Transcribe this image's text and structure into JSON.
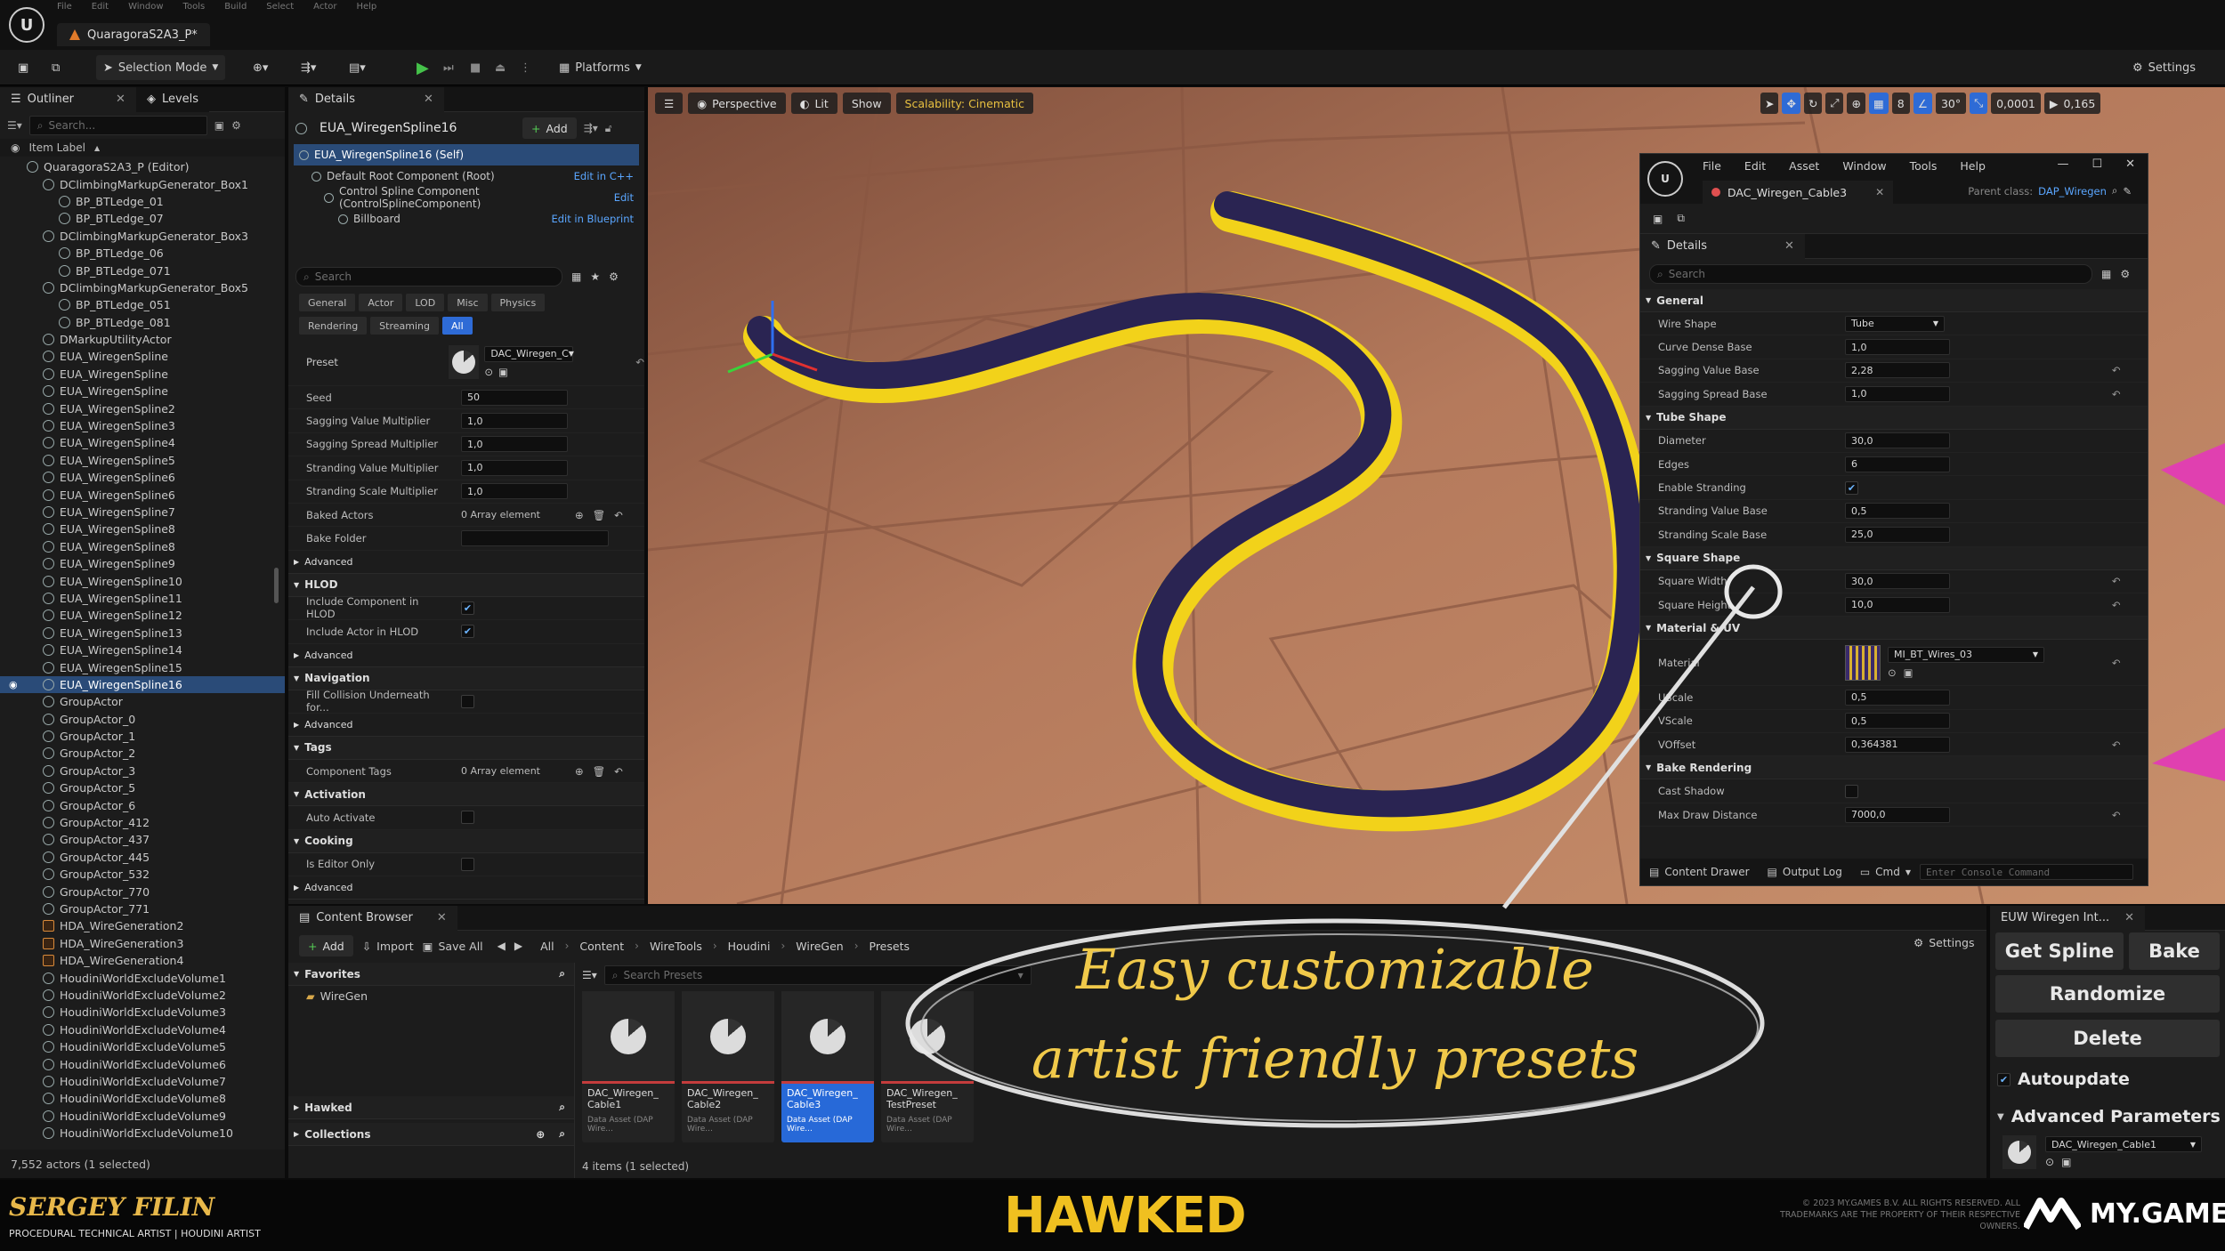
{
  "menu": {
    "items": [
      "File",
      "Edit",
      "Window",
      "Tools",
      "Build",
      "Select",
      "Actor",
      "Help"
    ]
  },
  "title_tab": "QuaragoraS2A3_P*",
  "toolbar": {
    "selection_mode": "Selection Mode",
    "platforms": "Platforms",
    "settings": "Settings"
  },
  "outliner": {
    "tab": "Outliner",
    "levels_tab": "Levels",
    "search_placeholder": "Search...",
    "column": "Item Label",
    "rows": [
      {
        "label": "QuaragoraS2A3_P (Editor)",
        "indent": 1
      },
      {
        "label": "DClimbingMarkupGenerator_Box1",
        "indent": 2
      },
      {
        "label": "BP_BTLedge_01",
        "indent": 3
      },
      {
        "label": "BP_BTLedge_07",
        "indent": 3
      },
      {
        "label": "DClimbingMarkupGenerator_Box3",
        "indent": 2
      },
      {
        "label": "BP_BTLedge_06",
        "indent": 3
      },
      {
        "label": "BP_BTLedge_071",
        "indent": 3
      },
      {
        "label": "DClimbingMarkupGenerator_Box5",
        "indent": 2
      },
      {
        "label": "BP_BTLedge_051",
        "indent": 3
      },
      {
        "label": "BP_BTLedge_081",
        "indent": 3
      },
      {
        "label": "DMarkupUtilityActor",
        "indent": 2
      },
      {
        "label": "EUA_WiregenSpline",
        "indent": 2
      },
      {
        "label": "EUA_WiregenSpline",
        "indent": 2
      },
      {
        "label": "EUA_WiregenSpline",
        "indent": 2
      },
      {
        "label": "EUA_WiregenSpline2",
        "indent": 2
      },
      {
        "label": "EUA_WiregenSpline3",
        "indent": 2
      },
      {
        "label": "EUA_WiregenSpline4",
        "indent": 2
      },
      {
        "label": "EUA_WiregenSpline5",
        "indent": 2
      },
      {
        "label": "EUA_WiregenSpline6",
        "indent": 2
      },
      {
        "label": "EUA_WiregenSpline6",
        "indent": 2
      },
      {
        "label": "EUA_WiregenSpline7",
        "indent": 2
      },
      {
        "label": "EUA_WiregenSpline8",
        "indent": 2
      },
      {
        "label": "EUA_WiregenSpline8",
        "indent": 2
      },
      {
        "label": "EUA_WiregenSpline9",
        "indent": 2
      },
      {
        "label": "EUA_WiregenSpline10",
        "indent": 2
      },
      {
        "label": "EUA_WiregenSpline11",
        "indent": 2
      },
      {
        "label": "EUA_WiregenSpline12",
        "indent": 2
      },
      {
        "label": "EUA_WiregenSpline13",
        "indent": 2
      },
      {
        "label": "EUA_WiregenSpline14",
        "indent": 2
      },
      {
        "label": "EUA_WiregenSpline15",
        "indent": 2
      },
      {
        "label": "EUA_WiregenSpline16",
        "indent": 2,
        "selected": true
      },
      {
        "label": "GroupActor",
        "indent": 2
      },
      {
        "label": "GroupActor_0",
        "indent": 2
      },
      {
        "label": "GroupActor_1",
        "indent": 2
      },
      {
        "label": "GroupActor_2",
        "indent": 2
      },
      {
        "label": "GroupActor_3",
        "indent": 2
      },
      {
        "label": "GroupActor_5",
        "indent": 2
      },
      {
        "label": "GroupActor_6",
        "indent": 2
      },
      {
        "label": "GroupActor_412",
        "indent": 2
      },
      {
        "label": "GroupActor_437",
        "indent": 2
      },
      {
        "label": "GroupActor_445",
        "indent": 2
      },
      {
        "label": "GroupActor_532",
        "indent": 2
      },
      {
        "label": "GroupActor_770",
        "indent": 2
      },
      {
        "label": "GroupActor_771",
        "indent": 2
      },
      {
        "label": "HDA_WireGeneration2",
        "indent": 2,
        "hda": true
      },
      {
        "label": "HDA_WireGeneration3",
        "indent": 2,
        "hda": true
      },
      {
        "label": "HDA_WireGeneration4",
        "indent": 2,
        "hda": true
      },
      {
        "label": "HoudiniWorldExcludeVolume1",
        "indent": 2
      },
      {
        "label": "HoudiniWorldExcludeVolume2",
        "indent": 2
      },
      {
        "label": "HoudiniWorldExcludeVolume3",
        "indent": 2
      },
      {
        "label": "HoudiniWorldExcludeVolume4",
        "indent": 2
      },
      {
        "label": "HoudiniWorldExcludeVolume5",
        "indent": 2
      },
      {
        "label": "HoudiniWorldExcludeVolume6",
        "indent": 2
      },
      {
        "label": "HoudiniWorldExcludeVolume7",
        "indent": 2
      },
      {
        "label": "HoudiniWorldExcludeVolume8",
        "indent": 2
      },
      {
        "label": "HoudiniWorldExcludeVolume9",
        "indent": 2
      },
      {
        "label": "HoudiniWorldExcludeVolume10",
        "indent": 2
      }
    ],
    "status": "7,552 actors (1 selected)"
  },
  "details": {
    "tab": "Details",
    "actor": "EUA_WiregenSpline16",
    "add": "Add",
    "components": [
      {
        "label": "EUA_WiregenSpline16 (Self)",
        "link": ""
      },
      {
        "label": "Default Root Component (Root)",
        "link": "Edit in C++"
      },
      {
        "label": "Control Spline Component (ControlSplineComponent)",
        "link": "Edit"
      },
      {
        "label": "Billboard",
        "link": "Edit in Blueprint"
      }
    ],
    "search_placeholder": "Search",
    "filters_row1": [
      "General",
      "Actor",
      "LOD",
      "Misc",
      "Physics"
    ],
    "filters_row2": [
      "Rendering",
      "Streaming",
      "All"
    ],
    "preset_label": "Preset",
    "preset_value": "DAC_Wiregen_C",
    "props": [
      {
        "label": "Seed",
        "value": "50"
      },
      {
        "label": "Sagging Value Multiplier",
        "value": "1,0"
      },
      {
        "label": "Sagging Spread Multiplier",
        "value": "1,0"
      },
      {
        "label": "Stranding Value Multiplier",
        "value": "1,0"
      },
      {
        "label": "Stranding Scale Multiplier",
        "value": "1,0"
      }
    ],
    "baked_actors": "Baked Actors",
    "array_element": "0 Array element",
    "bake_folder": "Bake Folder",
    "advanced": "Advanced",
    "hlod": "HLOD",
    "include_component": "Include Component in HLOD",
    "include_actor": "Include Actor in HLOD",
    "navigation": "Navigation",
    "fill_collision": "Fill Collision Underneath for...",
    "tags": "Tags",
    "component_tags": "Component Tags",
    "activation": "Activation",
    "auto_activate": "Auto Activate",
    "cooking": "Cooking",
    "is_editor_only": "Is Editor Only"
  },
  "viewport": {
    "perspective": "Perspective",
    "lit": "Lit",
    "show": "Show",
    "scalability": "Scalability: Cinematic",
    "grid": "8",
    "angle": "30°",
    "scale": "0,0001",
    "speed": "0,165"
  },
  "asset_editor": {
    "menu": [
      "File",
      "Edit",
      "Asset",
      "Window",
      "Tools",
      "Help"
    ],
    "tab": "DAC_Wiregen_Cable3",
    "parent_label": "Parent class:",
    "parent_value": "DAP_Wiregen",
    "details_tab": "Details",
    "search_placeholder": "Search",
    "sections": [
      {
        "name": "General",
        "props": [
          {
            "label": "Wire Shape",
            "value": "Tube",
            "type": "dropdown"
          },
          {
            "label": "Curve Dense Base",
            "value": "1,0"
          },
          {
            "label": "Sagging Value Base",
            "value": "2,28",
            "reset": true
          },
          {
            "label": "Sagging Spread Base",
            "value": "1,0",
            "reset": true
          }
        ]
      },
      {
        "name": "Tube Shape",
        "props": [
          {
            "label": "Diameter",
            "value": "30,0"
          },
          {
            "label": "Edges",
            "value": "6"
          },
          {
            "label": "Enable Stranding",
            "value": "",
            "type": "check"
          },
          {
            "label": "Stranding Value Base",
            "value": "0,5"
          },
          {
            "label": "Stranding Scale Base",
            "value": "25,0"
          }
        ]
      },
      {
        "name": "Square Shape",
        "props": [
          {
            "label": "Square Width",
            "value": "30,0",
            "reset": true
          },
          {
            "label": "Square Height",
            "value": "10,0",
            "reset": true
          }
        ]
      },
      {
        "name": "Material & UV",
        "props": [
          {
            "label": "Material",
            "value": "MI_BT_Wires_03",
            "type": "material",
            "reset": true
          },
          {
            "label": "UScale",
            "value": "0,5"
          },
          {
            "label": "VScale",
            "value": "0,5"
          },
          {
            "label": "VOffset",
            "value": "0,364381",
            "reset": true
          }
        ]
      },
      {
        "name": "Bake Rendering",
        "props": [
          {
            "label": "Cast Shadow",
            "value": "",
            "type": "check_off"
          },
          {
            "label": "Max Draw Distance",
            "value": "7000,0",
            "reset": true
          }
        ]
      }
    ],
    "footer": {
      "content_drawer": "Content Drawer",
      "output_log": "Output Log",
      "cmd": "Cmd",
      "console_placeholder": "Enter Console Command"
    }
  },
  "content_browser": {
    "tab": "Content Browser",
    "add": "Add",
    "import": "Import",
    "save_all": "Save All",
    "settings": "Settings",
    "breadcrumbs": [
      "All",
      "Content",
      "WireTools",
      "Houdini",
      "WireGen",
      "Presets"
    ],
    "favorites": "Favorites",
    "folder": "WireGen",
    "search_placeholder": "Search Presets",
    "hawked": "Hawked",
    "collections": "Collections",
    "assets": [
      {
        "name": "DAC_Wiregen_ Cable1",
        "type": "Data Asset (DAP Wire..."
      },
      {
        "name": "DAC_Wiregen_ Cable2",
        "type": "Data Asset (DAP Wire..."
      },
      {
        "name": "DAC_Wiregen_ Cable3",
        "type": "Data Asset (DAP Wire...",
        "selected": true
      },
      {
        "name": "DAC_Wiregen_ TestPreset",
        "type": "Data Asset (DAP Wire..."
      }
    ],
    "status": "4 items (1 selected)"
  },
  "utility": {
    "tab": "EUW Wiregen Int...",
    "get_spline": "Get Spline",
    "bake": "Bake",
    "randomize": "Randomize",
    "delete": "Delete",
    "autoupdate": "Autoupdate",
    "advanced": "Advanced Parameters",
    "preset": "DAC_Wiregen_Cable1"
  },
  "overlay": {
    "line1": "Easy customizable",
    "line2": "artist friendly presets"
  },
  "branding": {
    "author": "SERGEY FILIN",
    "role": "PROCEDURAL TECHNICAL ARTIST | HOUDINI ARTIST",
    "game": "HAWKED",
    "copyright": "© 2023 MY.GAMES B.V. ALL RIGHTS RESERVED. ALL TRADEMARKS ARE THE PROPERTY OF THEIR RESPECTIVE OWNERS.",
    "publisher": "MY.GAMES"
  },
  "colors": {
    "accent": "#2e6bd6",
    "wire_yellow": "#f2d21a",
    "wire_dark": "#2a2452",
    "floor": "#b87a5c",
    "selection": "#2a4b78"
  }
}
